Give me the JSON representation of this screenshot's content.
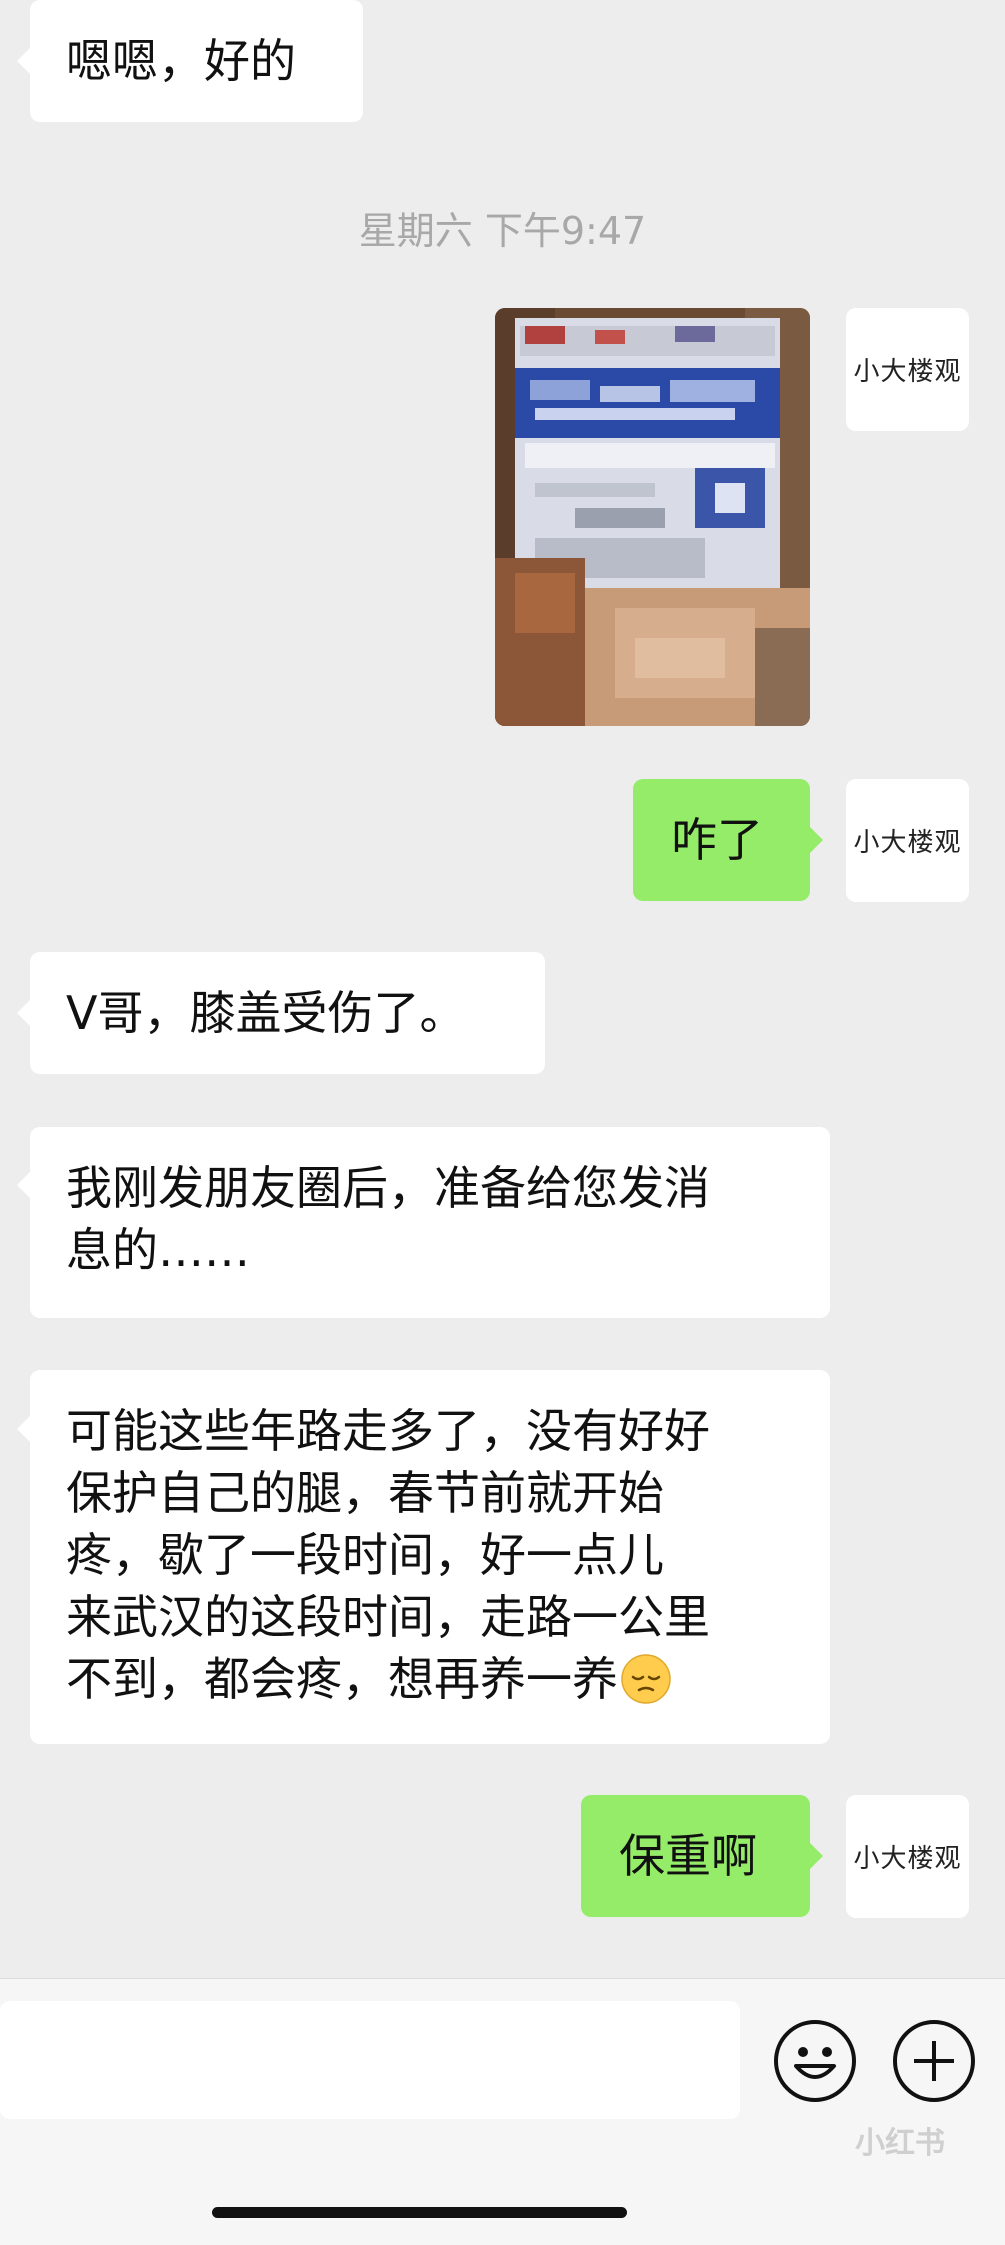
{
  "chat": {
    "messages": [
      {
        "side": "in",
        "text": "嗯嗯，好的"
      },
      {
        "side": "out",
        "kind": "image",
        "description": "pixelated photo of a medicated patch package"
      },
      {
        "side": "out",
        "text": "咋了"
      },
      {
        "side": "in",
        "text": "V哥，膝盖受伤了。"
      },
      {
        "side": "in",
        "lines": [
          "我刚发朋友圈后，准备给您发消",
          "息的……"
        ]
      },
      {
        "side": "in",
        "lines": [
          "可能这些年路走多了，没有好好",
          "保护自己的腿，春节前就开始",
          "疼，歇了一段时间，好一点儿",
          "来武汉的这段时间，走路一公里",
          "不到，都会疼，想再养一养"
        ],
        "emoji": "pensive-face"
      },
      {
        "side": "out",
        "text": "保重啊"
      }
    ],
    "timestamp": "星期六 下午9:47",
    "avatar_text": "小大楼观"
  },
  "composer": {
    "emoji_icon": "smiley-icon",
    "plus_icon": "plus-icon"
  },
  "watermark": {
    "text": "小红书"
  },
  "colors": {
    "background": "#ededed",
    "bubble_in": "#ffffff",
    "bubble_out": "#95ec69",
    "timestamp": "#a8a8a8"
  }
}
